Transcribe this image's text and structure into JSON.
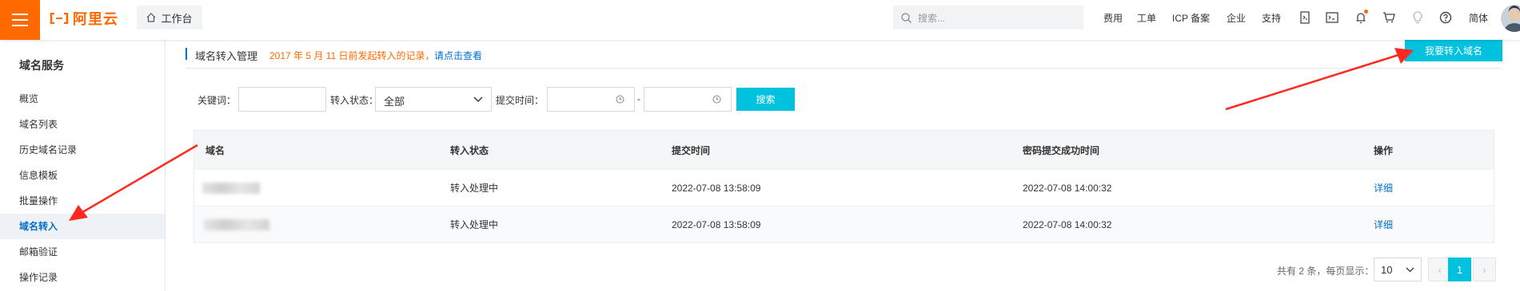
{
  "topbar": {
    "logo_text": "阿里云",
    "console_label": "工作台",
    "search_placeholder": "搜索...",
    "nav": [
      "费用",
      "工单",
      "ICP 备案",
      "企业",
      "支持"
    ],
    "lang": "简体"
  },
  "sidebar": {
    "title": "域名服务",
    "items": [
      {
        "label": "概览"
      },
      {
        "label": "域名列表"
      },
      {
        "label": "历史域名记录"
      },
      {
        "label": "信息模板"
      },
      {
        "label": "批量操作"
      },
      {
        "label": "域名转入"
      },
      {
        "label": "邮箱验证"
      },
      {
        "label": "操作记录"
      }
    ],
    "active_index": 5
  },
  "header": {
    "title": "域名转入管理",
    "notice": "2017 年 5 月 11 日前发起转入的记录，",
    "notice_link": "请点击查看",
    "primary_button": "我要转入域名"
  },
  "filters": {
    "keyword_label": "关键词：",
    "keyword_value": "",
    "status_label": "转入状态：",
    "status_value": "全部",
    "time_label": "提交时间：",
    "time_separator": "-",
    "search_button": "搜索"
  },
  "table": {
    "columns": [
      "域名",
      "转入状态",
      "提交时间",
      "密码提交成功时间",
      "操作"
    ],
    "rows": [
      {
        "domain": "",
        "status": "转入处理中",
        "submit_time": "2022-07-08 13:58:09",
        "password_time": "2022-07-08 14:00:32",
        "action": "详细"
      },
      {
        "domain": "",
        "status": "转入处理中",
        "submit_time": "2022-07-08 13:58:09",
        "password_time": "2022-07-08 14:00:32",
        "action": "详细"
      }
    ]
  },
  "pagination": {
    "summary": "共有 2 条，每页显示：",
    "page_size": "10",
    "prev": "‹",
    "current_page": "1",
    "next": "›"
  },
  "colors": {
    "brand": "#ff6a00",
    "primary": "#00c1de",
    "link": "#0070cc",
    "annotation_arrow": "#ff2a1f"
  }
}
